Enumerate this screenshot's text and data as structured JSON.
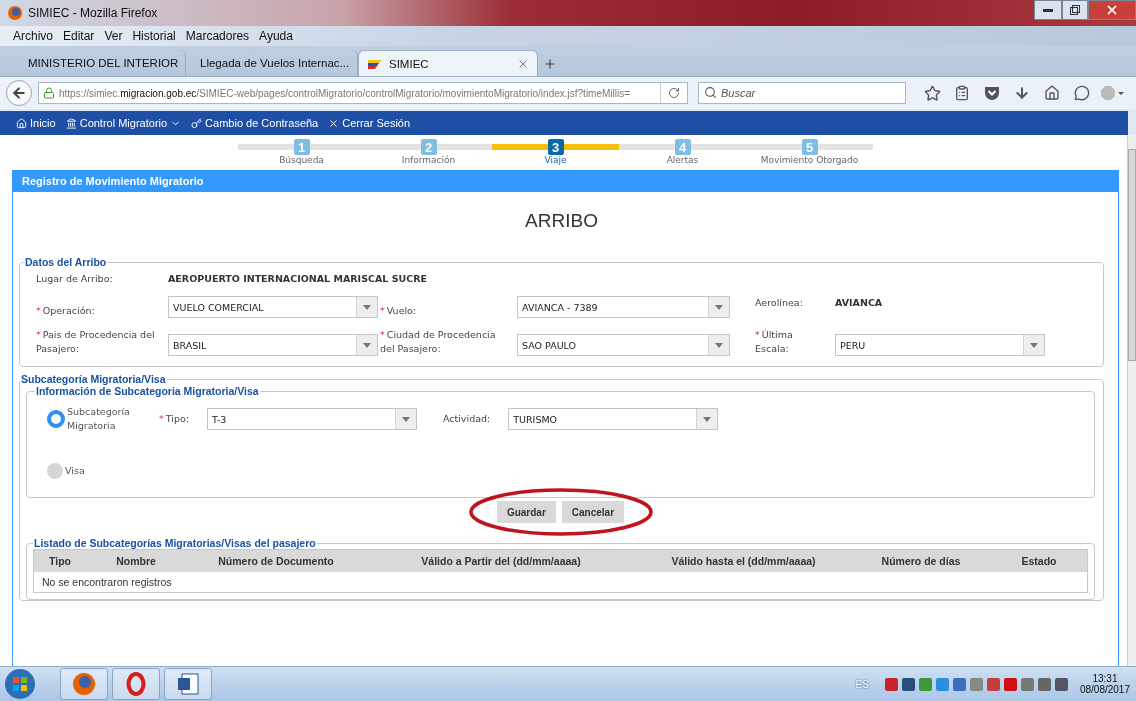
{
  "window": {
    "title": "SIMIEC - Mozilla Firefox"
  },
  "menu": [
    "Archivo",
    "Editar",
    "Ver",
    "Historial",
    "Marcadores",
    "Ayuda"
  ],
  "tabs": [
    {
      "label": "MINISTERIO DEL INTERIOR",
      "selected": false
    },
    {
      "label": "Llegada de Vuelos Internac...",
      "selected": false
    },
    {
      "label": "SIMIEC",
      "selected": true
    }
  ],
  "address": {
    "url": "https://simiec.**migracion.gob.ec**/SIMIEC-web/pages/controlMigratorio/controlMigratorio/movimientoMigratorio/index.jsf?timeMillis="
  },
  "search": {
    "placeholder": "Buscar"
  },
  "app_nav": [
    {
      "label": "Inicio",
      "has_menu": false
    },
    {
      "label": "Control Migratorio",
      "has_menu": true
    },
    {
      "label": "Cambio de Contraseña",
      "has_menu": false
    },
    {
      "label": "Cerrar Sesión",
      "has_menu": false
    }
  ],
  "steps": [
    {
      "number": "1",
      "label": "Búsqueda",
      "selected": false
    },
    {
      "number": "2",
      "label": "Información",
      "selected": false
    },
    {
      "number": "3",
      "label": "Viaje",
      "selected": true
    },
    {
      "number": "4",
      "label": "Alertas",
      "selected": false
    },
    {
      "number": "5",
      "label": "Movimiento Otorgado",
      "selected": false
    }
  ],
  "panel": {
    "title": "Registro de Movimiento Migratorio",
    "heading": "ARRIBO"
  },
  "arribo": {
    "legend": "Datos del Arribo",
    "rows": [
      [
        {
          "kind": "text",
          "label": "Lugar de Arribo:",
          "value": "AEROPUERTO INTERNACIONAL MARISCAL SUCRE"
        }
      ],
      [
        {
          "kind": "select",
          "required_mark": "*",
          "label": "Operación:",
          "value": "VUELO COMERCIAL"
        },
        {
          "kind": "select",
          "required_mark": "*",
          "label": "Vuelo:",
          "value": "AVIANCA - 7389"
        },
        {
          "kind": "text",
          "label": "Aerolínea:",
          "value": "AVIANCA"
        }
      ],
      [
        {
          "kind": "select",
          "required_mark": "*",
          "label": "Pais de Procedencia del Pasajero:",
          "value": "BRASIL"
        },
        {
          "kind": "select",
          "required_mark": "*",
          "label": "Ciudad de Procedencia del Pasajero:",
          "value": "SAO PAULO"
        },
        {
          "kind": "select",
          "required_mark": "*",
          "label": "Última Escala:",
          "value": "PERU"
        }
      ]
    ]
  },
  "subcategoria": {
    "legend": "Subcategoría Migratoria/Visa",
    "inner_legend": "Información de Subcategoria Migratoria/Visa",
    "options": [
      {
        "label": "Subcategoría Migratoria",
        "selected": true
      },
      {
        "label": "Visa",
        "selected": false
      }
    ],
    "tipo": {
      "required_mark": "*",
      "label": "Tipo:",
      "value": "T-3"
    },
    "actividad": {
      "label": "Actividad:",
      "value": "TURISMO"
    }
  },
  "buttons": [
    "Guardar",
    "Cancelar"
  ],
  "listado": {
    "legend": "Listado de Subcategorías Migratorias/Visas del pasajero",
    "columns": [
      "Tipo",
      "Nombre",
      "Número de Documento",
      "Válido a Partir del (dd/mm/aaaa)",
      "Válido hasta el (dd/mm/aaaa)",
      "Número de días",
      "Estado"
    ],
    "empty_message": "No se encontraron registros"
  },
  "taskbar": {
    "language": "ES",
    "time": "13:31",
    "date": "08/08/2017"
  }
}
